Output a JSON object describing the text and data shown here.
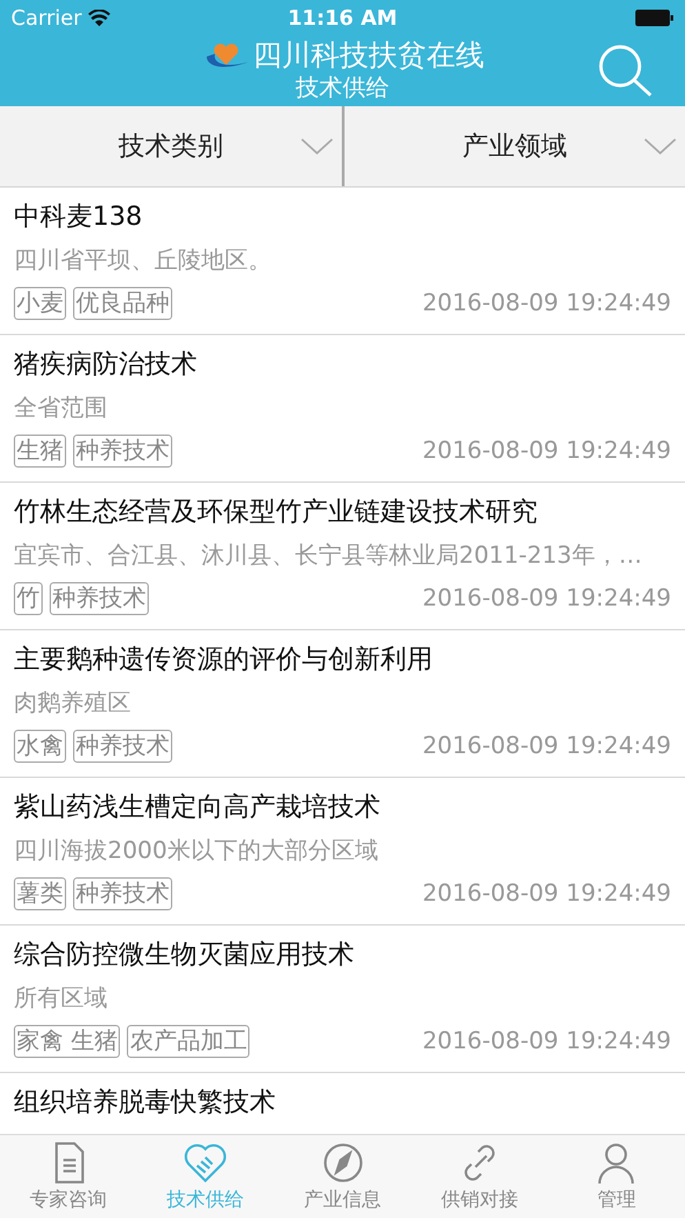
{
  "status_bar": {
    "carrier": "Carrier",
    "time": "11:16 AM"
  },
  "header": {
    "title": "四川科技扶贫在线",
    "subtitle": "技术供给"
  },
  "filters": [
    {
      "label": "技术类别"
    },
    {
      "label": "产业领域"
    }
  ],
  "items": [
    {
      "title": "中科麦138",
      "area": "四川省平坝、丘陵地区。",
      "tags": [
        "小麦",
        "优良品种"
      ],
      "date": "2016-08-09 19:24:49"
    },
    {
      "title": "猪疾病防治技术",
      "area": "全省范围",
      "tags": [
        "生猪",
        "种养技术"
      ],
      "date": "2016-08-09 19:24:49"
    },
    {
      "title": "竹林生态经营及环保型竹产业链建设技术研究",
      "area": "宜宾市、合江县、沐川县、长宁县等林业局2011-213年，…",
      "tags": [
        "竹",
        "种养技术"
      ],
      "date": "2016-08-09 19:24:49"
    },
    {
      "title": "主要鹅种遗传资源的评价与创新利用",
      "area": "肉鹅养殖区",
      "tags": [
        "水禽",
        "种养技术"
      ],
      "date": "2016-08-09 19:24:49"
    },
    {
      "title": "紫山药浅生槽定向高产栽培技术",
      "area": "四川海拔2000米以下的大部分区域",
      "tags": [
        "薯类",
        "种养技术"
      ],
      "date": "2016-08-09 19:24:49"
    },
    {
      "title": "综合防控微生物灭菌应用技术",
      "area": "所有区域",
      "tags": [
        "家禽 生猪",
        "农产品加工"
      ],
      "date": "2016-08-09 19:24:49"
    },
    {
      "title": "组织培养脱毒快繁技术"
    }
  ],
  "tabs": [
    {
      "label": "专家咨询",
      "kind": "document",
      "selected": false
    },
    {
      "label": "技术供给",
      "kind": "handshake",
      "selected": true
    },
    {
      "label": "产业信息",
      "kind": "compass",
      "selected": false
    },
    {
      "label": "供销对接",
      "kind": "link",
      "selected": false
    },
    {
      "label": "管理",
      "kind": "person",
      "selected": false
    }
  ]
}
